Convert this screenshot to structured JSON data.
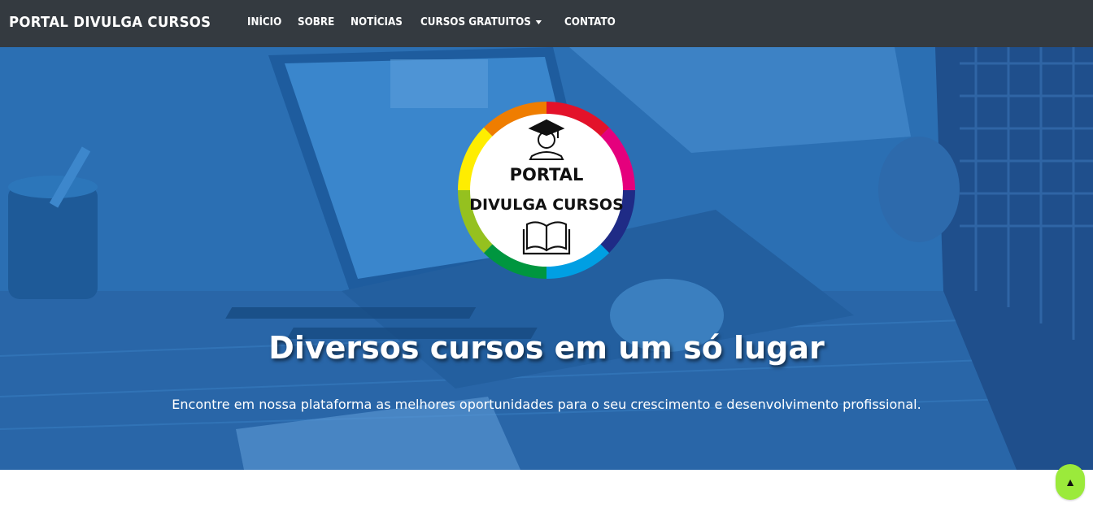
{
  "navbar": {
    "brand": "PORTAL DIVULGA CURSOS",
    "items": [
      {
        "label": "INÍCIO"
      },
      {
        "label": "SOBRE"
      },
      {
        "label": "NOTÍCIAS"
      },
      {
        "label": "CURSOS GRATUITOS",
        "dropdown": true
      },
      {
        "label": "CONTATO"
      }
    ]
  },
  "logo": {
    "line1": "PORTAL",
    "line2": "DIVULGA CURSOS",
    "icons": [
      "graduate-icon",
      "open-book-icon"
    ],
    "ring_colors": [
      "#e3122a",
      "#e5007d",
      "#1f2b86",
      "#009fe3",
      "#00963f",
      "#95c11f",
      "#ffed00",
      "#ef7d00"
    ]
  },
  "hero": {
    "title": "Diversos cursos em um só lugar",
    "subtitle": "Encontre em nossa plataforma as melhores oportunidades para o seu crescimento e desenvolvimento profissional."
  },
  "back_to_top": {
    "icon": "arrow-up-icon",
    "glyph": "▲"
  },
  "colors": {
    "navbar": "#343a40",
    "hero_tint": "#2a6fb3",
    "back_to_top": "#9bea3b"
  }
}
